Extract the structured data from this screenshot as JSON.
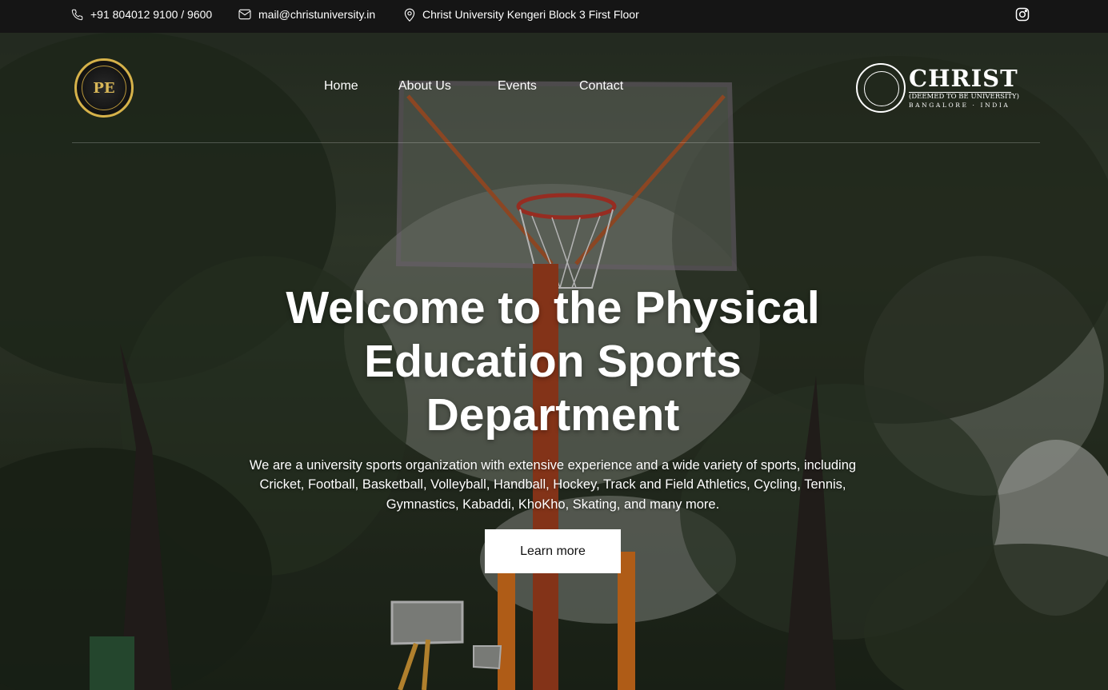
{
  "topbar": {
    "phone": "+91 804012 9100 / 9600",
    "email": "mail@christuniversity.in",
    "location": "Christ University Kengeri Block 3 First Floor",
    "phone_icon": "phone-icon",
    "mail_icon": "mail-icon",
    "location_icon": "map-pin-icon",
    "social_icon": "instagram-icon"
  },
  "header": {
    "department_logo": "department-logo",
    "nav": [
      {
        "label": "Home"
      },
      {
        "label": "About Us"
      },
      {
        "label": "Events"
      },
      {
        "label": "Contact"
      }
    ],
    "university_logo": {
      "name": "CHRIST",
      "line1": "(DEEMED TO BE UNIVERSITY)",
      "line2": "BANGALORE · INDIA"
    }
  },
  "hero": {
    "title": "Welcome to the Physical Education Sports Department",
    "description": "We are a university sports organization with extensive experience and a wide variety of sports, including Cricket, Football, Basketball, Volleyball, Handball, Hockey, Track and Field Athletics, Cycling, Tennis, Gymnastics, Kabaddi, KhoKho, Skating, and many more.",
    "cta_label": "Learn more"
  },
  "colors": {
    "topbar_bg": "#151515",
    "logo_gold": "#d6b24a",
    "pole_orange": "#e0761e",
    "button_bg": "#ffffff"
  }
}
